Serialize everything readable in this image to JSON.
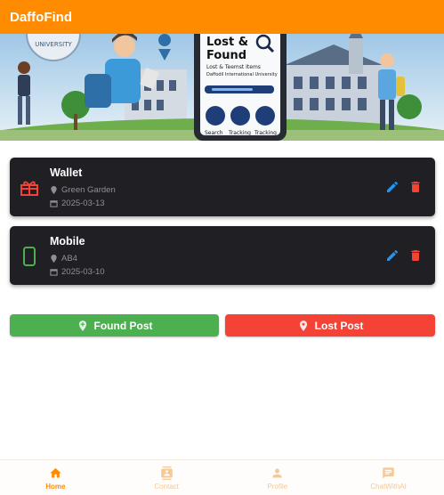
{
  "app": {
    "title": "DaffoFind"
  },
  "banner": {
    "phone_heading_line1": "Lost &",
    "phone_heading_line2": "Found",
    "phone_subtitle_line1": "Lost & Teemst Items",
    "phone_subtitle_line2": "Daffodil International University",
    "phone_features": [
      "Search",
      "Tracking",
      "Tracking"
    ],
    "badge_text": "UNIVERSITY"
  },
  "posts": [
    {
      "title": "Wallet",
      "location": "Green Garden",
      "date": "2025-03-13",
      "icon": "gift-icon",
      "icon_color": "#f44336"
    },
    {
      "title": "Mobile",
      "location": "AB4",
      "date": "2025-03-10",
      "icon": "phone-icon",
      "icon_color": "#4caf50"
    }
  ],
  "actions": {
    "found_label": "Found Post",
    "lost_label": "Lost Post"
  },
  "nav": [
    {
      "label": "Home",
      "icon": "home-icon",
      "active": true
    },
    {
      "label": "Contact",
      "icon": "contact-icon",
      "active": false
    },
    {
      "label": "Profile",
      "icon": "person-icon",
      "active": false
    },
    {
      "label": "ChatWithAI",
      "icon": "chat-icon",
      "active": false
    }
  ],
  "colors": {
    "primary": "#ff8c00",
    "card_bg": "#1f1f24",
    "edit": "#2196f3",
    "delete": "#f44336",
    "found": "#4caf50",
    "lost": "#f44336"
  }
}
